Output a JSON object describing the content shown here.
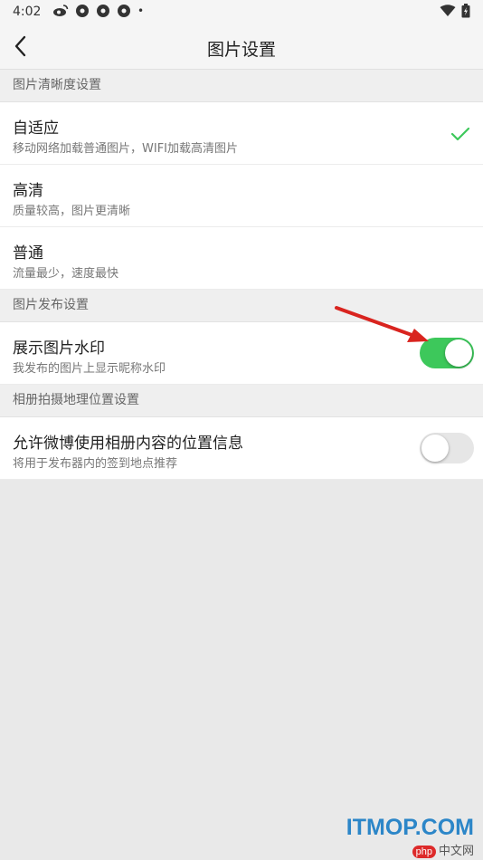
{
  "status_bar": {
    "time": "4:02",
    "dot": "•"
  },
  "header": {
    "title": "图片设置"
  },
  "sections": [
    {
      "title": "图片清晰度设置"
    },
    {
      "title": "图片发布设置"
    },
    {
      "title": "相册拍摄地理位置设置"
    }
  ],
  "quality_options": [
    {
      "title": "自适应",
      "subtitle": "移动网络加载普通图片，WIFI加载高清图片",
      "selected": true
    },
    {
      "title": "高清",
      "subtitle": "质量较高，图片更清晰",
      "selected": false
    },
    {
      "title": "普通",
      "subtitle": "流量最少，速度最快",
      "selected": false
    }
  ],
  "watermark_setting": {
    "title": "展示图片水印",
    "subtitle": "我发布的图片上显示昵称水印",
    "enabled": true
  },
  "location_setting": {
    "title": "允许微博使用相册内容的位置信息",
    "subtitle": "将用于发布器内的签到地点推荐",
    "enabled": false
  },
  "watermark_overlay": {
    "brand": "ITMOP.COM",
    "badge": "php",
    "site": "中文网"
  },
  "colors": {
    "accent_green": "#3dc85b",
    "arrow_red": "#d9241f"
  }
}
